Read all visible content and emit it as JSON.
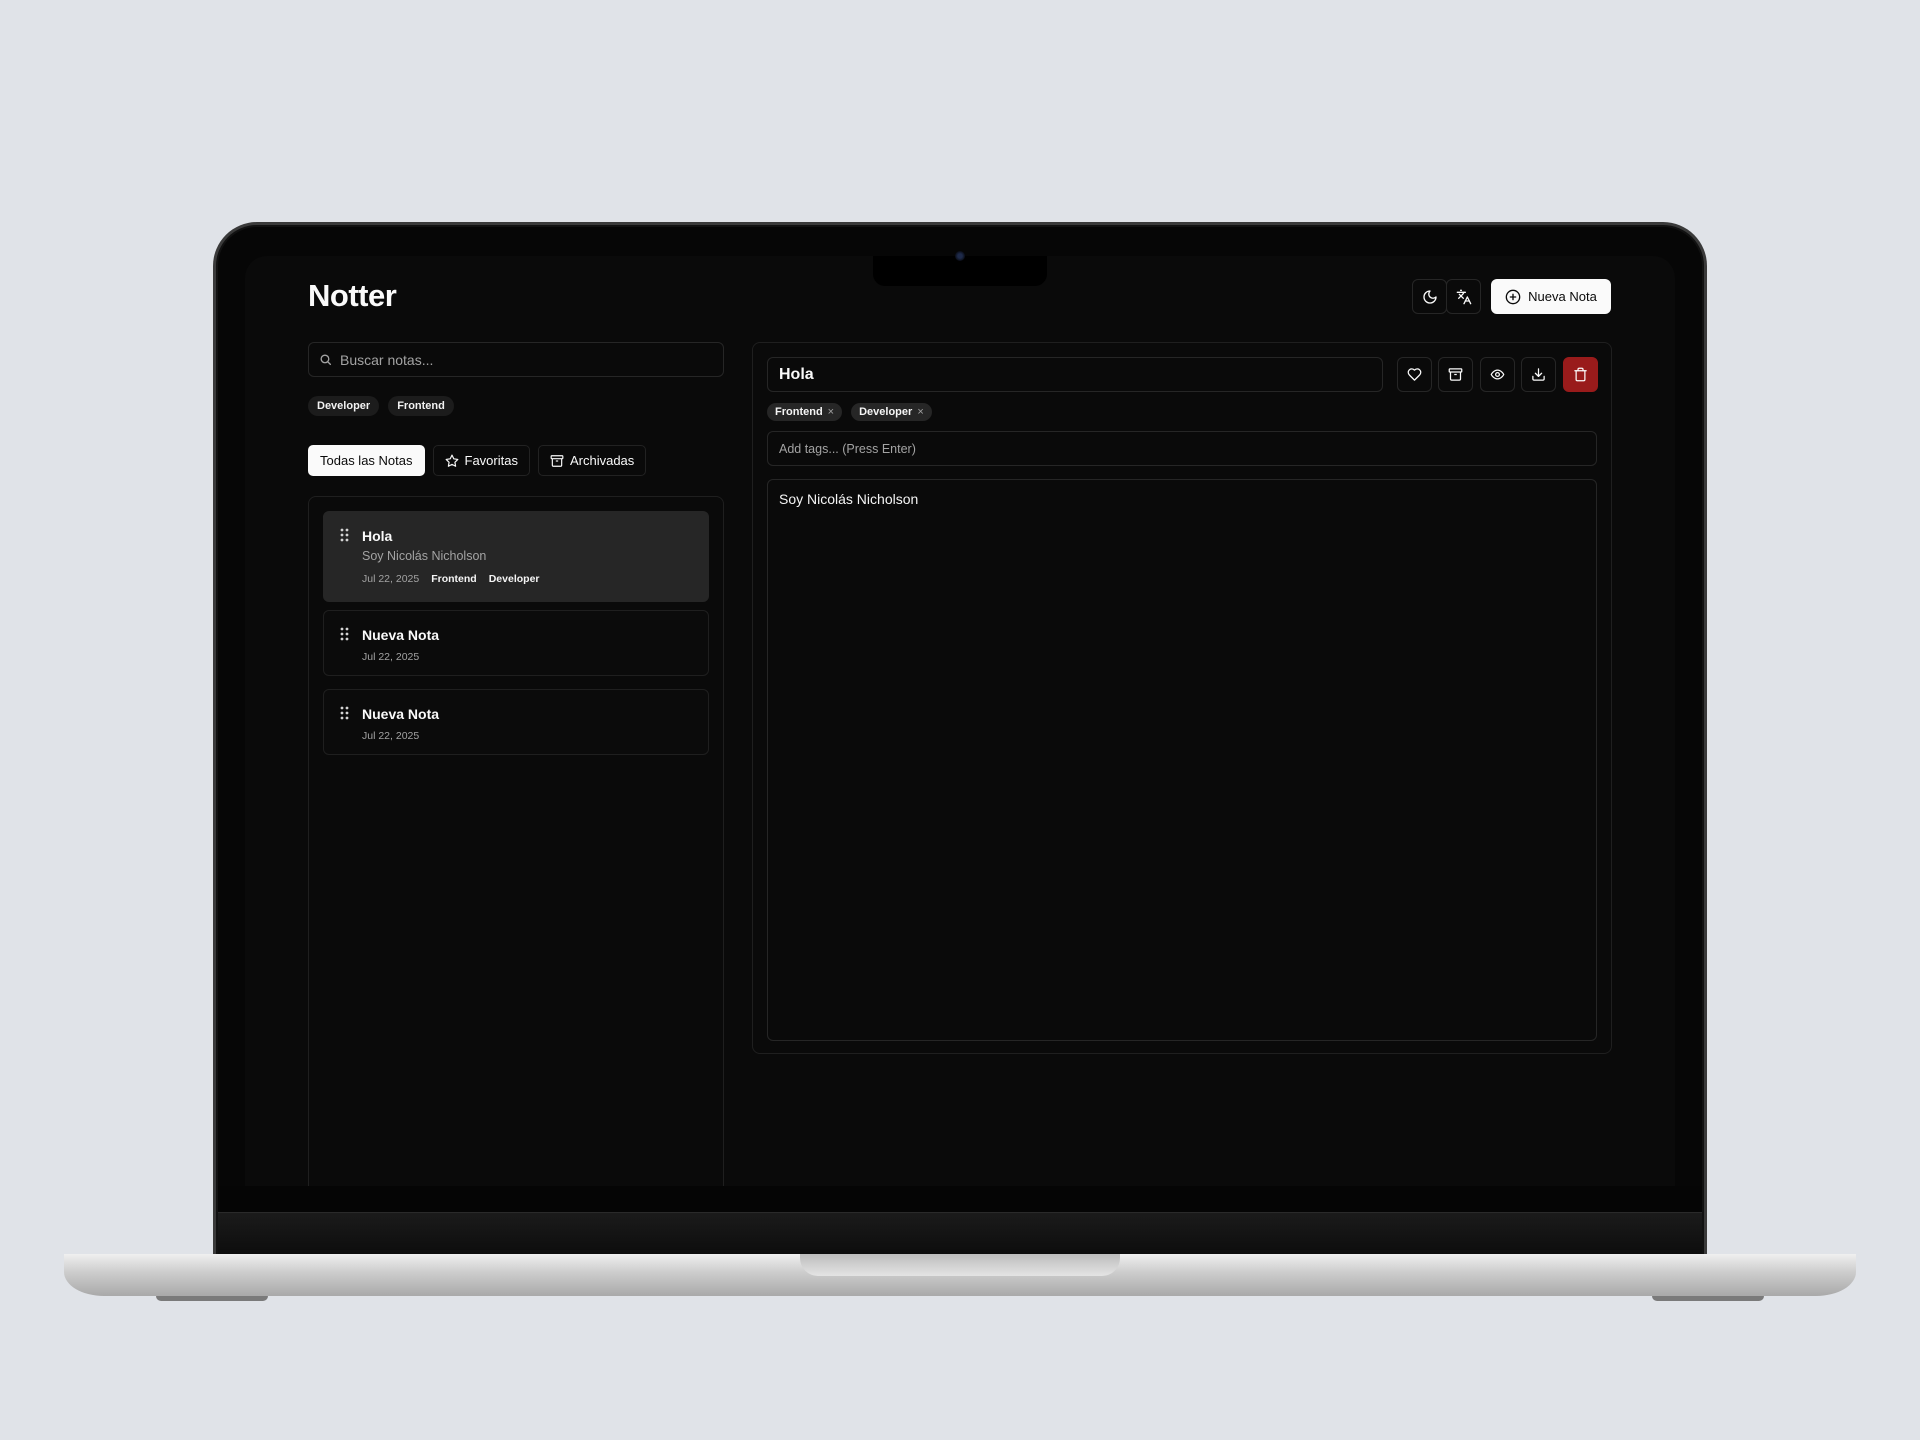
{
  "app": {
    "title": "Notter"
  },
  "header": {
    "theme_icon": "moon-icon",
    "language_icon": "translate-icon",
    "new_note_label": "Nueva Nota"
  },
  "sidebar": {
    "search_placeholder": "Buscar notas...",
    "tag_filters": [
      "Developer",
      "Frontend"
    ],
    "tabs": [
      {
        "label": "Todas las Notas",
        "icon": "",
        "active": true
      },
      {
        "label": "Favoritas",
        "icon": "star-icon",
        "active": false
      },
      {
        "label": "Archivadas",
        "icon": "archive-icon",
        "active": false
      }
    ],
    "notes": [
      {
        "title": "Hola",
        "snippet": "Soy Nicolás Nicholson",
        "date": "Jul 22, 2025",
        "tags": [
          "Frontend",
          "Developer"
        ],
        "active": true
      },
      {
        "title": "Nueva Nota",
        "snippet": "",
        "date": "Jul 22, 2025",
        "tags": [],
        "active": false
      },
      {
        "title": "Nueva Nota",
        "snippet": "",
        "date": "Jul 22, 2025",
        "tags": [],
        "active": false
      }
    ]
  },
  "editor": {
    "title_value": "Hola",
    "tags": [
      "Frontend",
      "Developer"
    ],
    "tag_remove_glyph": "×",
    "tags_placeholder": "Add tags... (Press Enter)",
    "content": "Soy Nicolás Nicholson",
    "toolbar_icons": [
      "heart-icon",
      "archive-icon",
      "eye-icon",
      "download-icon",
      "trash-icon"
    ]
  },
  "colors": {
    "background": "#0a0a0a",
    "primary": "#fafafa",
    "border": "#262626",
    "danger": "#991b1b"
  }
}
